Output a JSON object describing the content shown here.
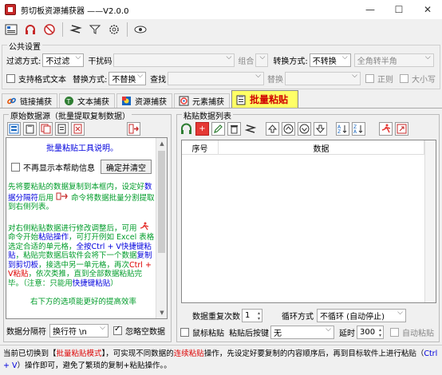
{
  "window": {
    "title": "剪切板资源捕获器      ——V2.0.0",
    "minimize": "—",
    "maximize": "☐",
    "close": "✕"
  },
  "toolbar": {
    "icons": [
      "app-settings-icon",
      "headphones-icon",
      "no-sound-icon",
      "clipboard-capture-icon",
      "filter-icon",
      "gear-icon",
      "eye-icon"
    ]
  },
  "public_settings": {
    "title": "公共设置",
    "filter_label": "过滤方式:",
    "filter_value": "不过滤",
    "noise_label": "干扰码",
    "noise_value": "",
    "combine_label": "组合",
    "convert_label": "转换方式:",
    "convert_value": "不转换",
    "fullwidth_value": "全角转半角",
    "rich_text_label": "支持格式文本",
    "replace_label": "替换方式:",
    "replace_value": "不替换",
    "find_label": "查找",
    "find_value": "",
    "replace_with_label": "替换",
    "replace_with_value": "",
    "regex_label": "正则",
    "case_label": "大小写"
  },
  "tabs": [
    {
      "label": "链接捕获",
      "icon": "link-icon"
    },
    {
      "label": "文本捕获",
      "icon": "text-icon"
    },
    {
      "label": "资源捕获",
      "icon": "resource-icon"
    },
    {
      "label": "元素捕获",
      "icon": "element-icon"
    },
    {
      "label": "批量粘贴",
      "icon": "batch-paste-icon",
      "active": true
    }
  ],
  "left_panel": {
    "title": "原始数据源（批量提取复制数据）",
    "help_title": "批量粘贴工具说明。",
    "no_show_label": "不再显示本帮助信息",
    "confirm_button": "确定并清空",
    "help_p1_a": "先将要粘贴的数据复制到本框内，设定好",
    "help_p1_b": "数据分隔符",
    "help_p1_c": "后用",
    "help_p1_d": "命令将数据批量分割提取到右侧列表。",
    "help_p2_a": "对右侧粘贴数据进行修改调整后，可用",
    "help_p2_b": "命令开始",
    "help_p2_c": "粘贴操作",
    "help_p2_d": "，可打开例如 Excel 表格选定合适的单元格，",
    "help_p2_e": "全按Ctrl + V快捷键粘贴",
    "help_p2_f": "，粘贴完数据后软件会将下一个数据",
    "help_p2_g": "复制到剪切板",
    "help_p2_h": "，接选中另一单元格，再次",
    "help_p2_i": "Ctrl + V粘贴",
    "help_p2_j": "，依次类推，直到全部数据粘贴完毕。（注意：只能用",
    "help_p2_k": "快捷键粘贴",
    "help_p2_l": "）",
    "help_p3": "右下方的选项能更好的提高效率",
    "separator_label": "数据分隔符",
    "separator_value": "换行符 \\n",
    "ignore_empty_label": "忽略空数据"
  },
  "right_panel": {
    "title": "粘贴数据列表",
    "col_index": "序号",
    "col_data": "数据",
    "repeat_label": "数据重复次数",
    "repeat_value": "1",
    "loop_label": "循环方式",
    "loop_value": "不循环 (自动停止)",
    "mouse_paste_label": "鼠标粘贴",
    "after_paste_label": "粘贴后按键",
    "after_paste_value": "无",
    "delay_label": "延时",
    "delay_value": "300",
    "auto_paste_label": "自动粘贴"
  },
  "status": {
    "a": "当前已切换到【",
    "b": "批量粘贴模式",
    "c": "】，可实现不同数据的",
    "d": "连续粘贴",
    "e": "操作，先设定好要复制的内容顺序后，再到目标软件上进行粘贴（",
    "f": "Ctrl + V",
    "g": "）操作即可，避免了繁琐的复制+粘贴操作。。"
  },
  "colors": {
    "accent_red": "#dd0000",
    "help_green": "#009c2a",
    "help_blue": "#0000dd",
    "active_tab": "#ffff66"
  }
}
